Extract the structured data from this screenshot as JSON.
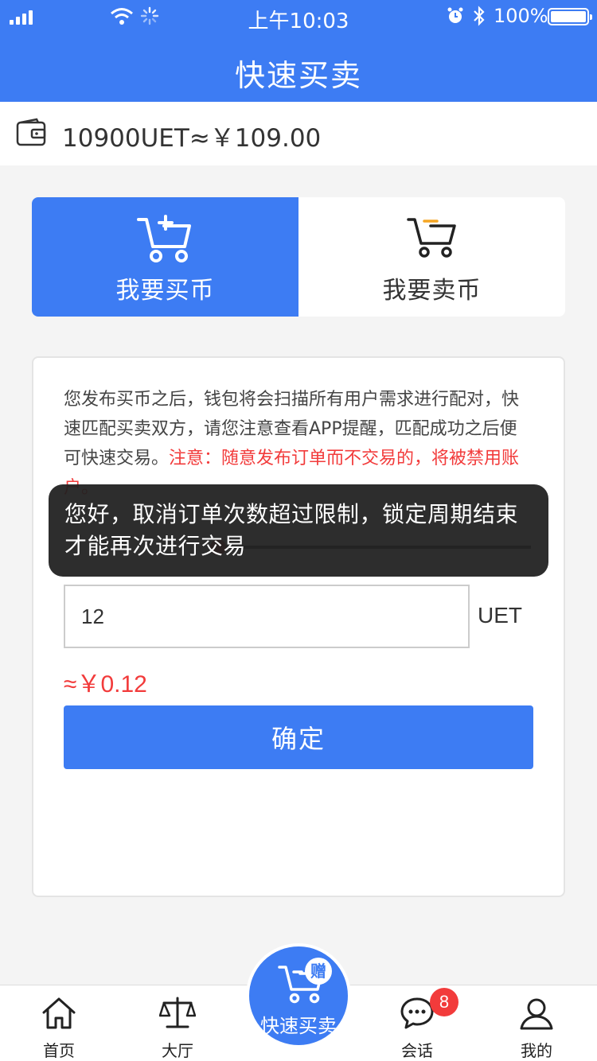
{
  "status_bar": {
    "time": "上午10:03",
    "battery": "100%"
  },
  "nav": {
    "title": "快速买卖"
  },
  "wallet": {
    "balance": "10900UET≈￥109.00",
    "icon": "wallet-icon"
  },
  "tabs": [
    {
      "label": "我要买币",
      "icon": "cart-plus-icon",
      "active": true
    },
    {
      "label": "我要卖币",
      "icon": "cart-minus-icon",
      "active": false
    }
  ],
  "notice": {
    "text": "您发布买币之后，钱包将会扫描所有用户需求进行配对，快速匹配买卖双方，请您注意查看APP提醒，匹配成功之后便可快速交易。",
    "warning": "注意：随意发布订单而不交易的，将被禁用账户。"
  },
  "form": {
    "amount_value": "12",
    "unit": "UET",
    "approx": "≈￥0.12",
    "confirm_label": "确定"
  },
  "toast": {
    "message": "您好，取消订单次数超过限制，锁定周期结束才能再次进行交易"
  },
  "tabbar": {
    "items": [
      {
        "label": "首页",
        "icon": "home-icon"
      },
      {
        "label": "大厅",
        "icon": "scale-icon"
      },
      {
        "label": "快速买卖",
        "icon": "cart-icon"
      },
      {
        "label": "会话",
        "icon": "chat-icon",
        "badge": "8"
      },
      {
        "label": "我的",
        "icon": "user-icon"
      }
    ],
    "gift": "赠"
  },
  "colors": {
    "primary": "#3d7cf3",
    "warning": "#f23b3b"
  }
}
